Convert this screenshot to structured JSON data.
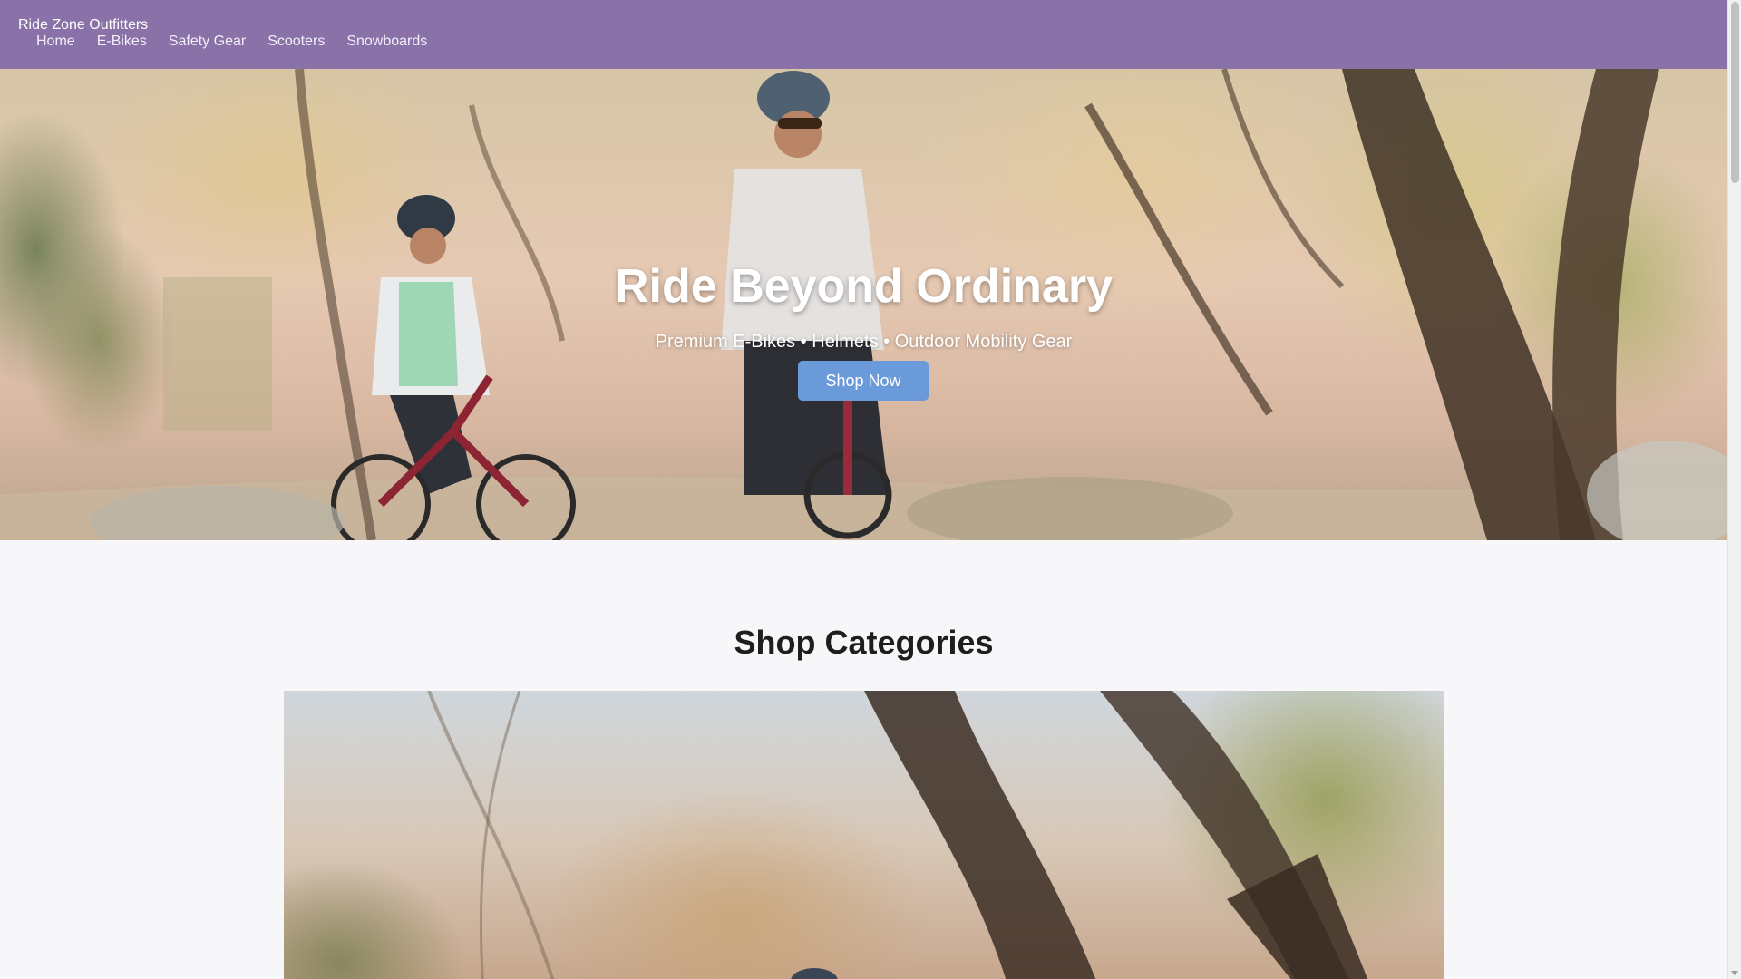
{
  "header": {
    "brand": "Ride Zone Outfitters",
    "nav": [
      "Home",
      "E-Bikes",
      "Safety Gear",
      "Scooters",
      "Snowboards"
    ]
  },
  "hero": {
    "title": "Ride Beyond Ordinary",
    "subtitle": "Premium E-Bikes • Helmets • Outdoor Mobility Gear",
    "cta_label": "Shop Now"
  },
  "categories": {
    "title": "Shop Categories"
  },
  "colors": {
    "header_bg": "#8a72a9",
    "cta_bg": "#6a9ad9",
    "page_bg": "#f7f7f9"
  },
  "icons": {
    "scroll_down": "chevron-down-icon"
  }
}
